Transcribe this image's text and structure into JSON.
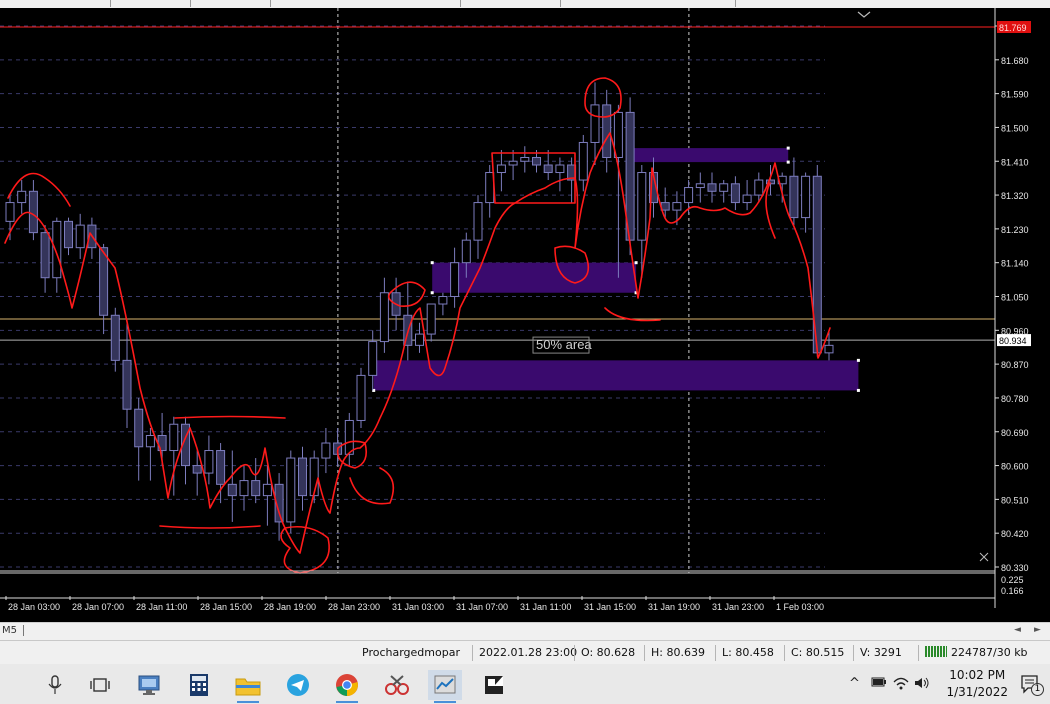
{
  "window": {
    "symbol_timeframe": "M5",
    "scroll_left_label": "◄",
    "scroll_right_label": "►"
  },
  "price_axis": {
    "labels": [
      "81.770",
      "81.680",
      "81.590",
      "81.500",
      "81.410",
      "81.320",
      "81.230",
      "81.140",
      "81.050",
      "80.960",
      "80.870",
      "80.780",
      "80.690",
      "80.600",
      "80.510",
      "80.420",
      "80.330"
    ],
    "current_price": "80.934",
    "top_marker": "81.769",
    "indicator_labels": [
      "0.225",
      "0.166"
    ]
  },
  "time_axis": {
    "labels": [
      "28 Jan 03:00",
      "28 Jan 07:00",
      "28 Jan 11:00",
      "28 Jan 15:00",
      "28 Jan 19:00",
      "28 Jan 23:00",
      "31 Jan 03:00",
      "31 Jan 07:00",
      "31 Jan 11:00",
      "31 Jan 15:00",
      "31 Jan 19:00",
      "31 Jan 23:00",
      "1 Feb 03:00"
    ]
  },
  "annotations": {
    "zone_label": "50% area"
  },
  "chart_data": {
    "type": "candlestick",
    "y_range": [
      80.33,
      81.77
    ],
    "ohlc": [
      [
        81.25,
        81.32,
        81.2,
        81.3
      ],
      [
        81.3,
        81.36,
        81.27,
        81.33
      ],
      [
        81.33,
        81.36,
        81.2,
        81.22
      ],
      [
        81.22,
        81.24,
        81.06,
        81.1
      ],
      [
        81.1,
        81.26,
        81.06,
        81.25
      ],
      [
        81.25,
        81.26,
        81.16,
        81.18
      ],
      [
        81.18,
        81.27,
        81.15,
        81.24
      ],
      [
        81.24,
        81.26,
        81.15,
        81.18
      ],
      [
        81.18,
        81.19,
        80.95,
        81.0
      ],
      [
        81.0,
        81.02,
        80.85,
        80.88
      ],
      [
        80.88,
        80.98,
        80.7,
        80.75
      ],
      [
        80.75,
        80.78,
        80.56,
        80.65
      ],
      [
        80.65,
        80.7,
        80.56,
        80.68
      ],
      [
        80.68,
        80.74,
        80.6,
        80.64
      ],
      [
        80.64,
        80.73,
        80.52,
        80.71
      ],
      [
        80.71,
        80.73,
        80.55,
        80.6
      ],
      [
        80.6,
        80.64,
        80.52,
        80.58
      ],
      [
        80.58,
        80.68,
        80.55,
        80.64
      ],
      [
        80.64,
        80.66,
        80.5,
        80.55
      ],
      [
        80.55,
        80.64,
        80.45,
        80.52
      ],
      [
        80.52,
        80.6,
        80.48,
        80.56
      ],
      [
        80.56,
        80.62,
        80.5,
        80.52
      ],
      [
        80.52,
        80.6,
        80.44,
        80.55
      ],
      [
        80.55,
        80.58,
        80.4,
        80.45
      ],
      [
        80.45,
        80.64,
        80.42,
        80.62
      ],
      [
        80.62,
        80.65,
        80.48,
        80.52
      ],
      [
        80.52,
        80.64,
        80.5,
        80.62
      ],
      [
        80.62,
        80.7,
        80.58,
        80.66
      ],
      [
        80.66,
        80.7,
        80.6,
        80.63
      ],
      [
        80.63,
        80.74,
        80.6,
        80.72
      ],
      [
        80.72,
        80.86,
        80.7,
        80.84
      ],
      [
        80.84,
        80.96,
        80.8,
        80.93
      ],
      [
        80.93,
        81.1,
        80.9,
        81.06
      ],
      [
        81.06,
        81.1,
        80.96,
        81.0
      ],
      [
        81.0,
        81.09,
        80.88,
        80.92
      ],
      [
        80.92,
        80.98,
        80.9,
        80.95
      ],
      [
        80.95,
        81.02,
        80.93,
        81.03
      ],
      [
        81.03,
        81.06,
        81.0,
        81.05
      ],
      [
        81.05,
        81.18,
        81.02,
        81.14
      ],
      [
        81.14,
        81.22,
        81.1,
        81.2
      ],
      [
        81.2,
        81.32,
        81.15,
        81.3
      ],
      [
        81.3,
        81.4,
        81.26,
        81.38
      ],
      [
        81.38,
        81.44,
        81.33,
        81.4
      ],
      [
        81.4,
        81.44,
        81.36,
        81.41
      ],
      [
        81.41,
        81.45,
        81.38,
        81.42
      ],
      [
        81.42,
        81.44,
        81.38,
        81.4
      ],
      [
        81.4,
        81.44,
        81.36,
        81.38
      ],
      [
        81.38,
        81.42,
        81.33,
        81.4
      ],
      [
        81.4,
        81.42,
        81.3,
        81.36
      ],
      [
        81.36,
        81.48,
        81.33,
        81.46
      ],
      [
        81.46,
        81.62,
        81.4,
        81.56
      ],
      [
        81.56,
        81.6,
        81.38,
        81.42
      ],
      [
        81.42,
        81.56,
        81.1,
        81.54
      ],
      [
        81.54,
        81.58,
        81.16,
        81.2
      ],
      [
        81.2,
        81.4,
        81.1,
        81.38
      ],
      [
        81.38,
        81.42,
        81.26,
        81.3
      ],
      [
        81.3,
        81.34,
        81.26,
        81.28
      ],
      [
        81.28,
        81.33,
        81.24,
        81.3
      ],
      [
        81.3,
        81.36,
        81.27,
        81.34
      ],
      [
        81.34,
        81.38,
        81.3,
        81.35
      ],
      [
        81.35,
        81.38,
        81.3,
        81.33
      ],
      [
        81.33,
        81.36,
        81.3,
        81.35
      ],
      [
        81.35,
        81.37,
        81.28,
        81.3
      ],
      [
        81.3,
        81.36,
        81.28,
        81.32
      ],
      [
        81.32,
        81.38,
        81.3,
        81.36
      ],
      [
        81.36,
        81.4,
        81.32,
        81.35
      ],
      [
        81.35,
        81.38,
        81.3,
        81.37
      ],
      [
        81.37,
        81.42,
        81.24,
        81.26
      ],
      [
        81.26,
        81.38,
        81.22,
        81.37
      ],
      [
        81.37,
        81.4,
        80.89,
        80.9
      ],
      [
        80.9,
        80.96,
        80.88,
        80.92
      ]
    ],
    "zones": [
      {
        "from": 81.42,
        "to": 81.445,
        "start_bar": 53,
        "end_bar": 66
      },
      {
        "from": 81.06,
        "to": 81.14,
        "start_bar": 36,
        "end_bar": 53
      },
      {
        "from": 80.8,
        "to": 80.88,
        "start_bar": 31,
        "end_bar": 72
      }
    ],
    "horizontal_lines": [
      {
        "price": 80.99,
        "color": "#d8b46e"
      },
      {
        "price": 80.934,
        "color": "#b0b0b0"
      },
      {
        "price": 81.769,
        "color": "#ff2020"
      }
    ],
    "vertical_lines_bar": [
      27,
      57
    ]
  },
  "status_bar": {
    "profile": "Prochargedmopar",
    "datetime": "2022.01.28 23:00",
    "open": "O: 80.628",
    "high": "H: 80.639",
    "low": "L: 80.458",
    "close": "C: 80.515",
    "volume": "V: 3291",
    "traffic": "224787/30 kb"
  },
  "taskbar": {
    "time": "10:02 PM",
    "date": "1/31/2022",
    "notification_count": "1",
    "apps": [
      "microphone",
      "task-view",
      "remote-desktop",
      "calculator",
      "file-explorer",
      "telegram",
      "chrome",
      "snipping-tool",
      "metatrader",
      "sticky-notes"
    ]
  },
  "colors": {
    "candle_bull_fill": "#000000",
    "candle_border": "#7d7dbe",
    "candle_bear_fill": "#34345a",
    "zone": "#3a0a6e",
    "drawing": "#ff1a1a",
    "grid": "#3a3a6a"
  }
}
